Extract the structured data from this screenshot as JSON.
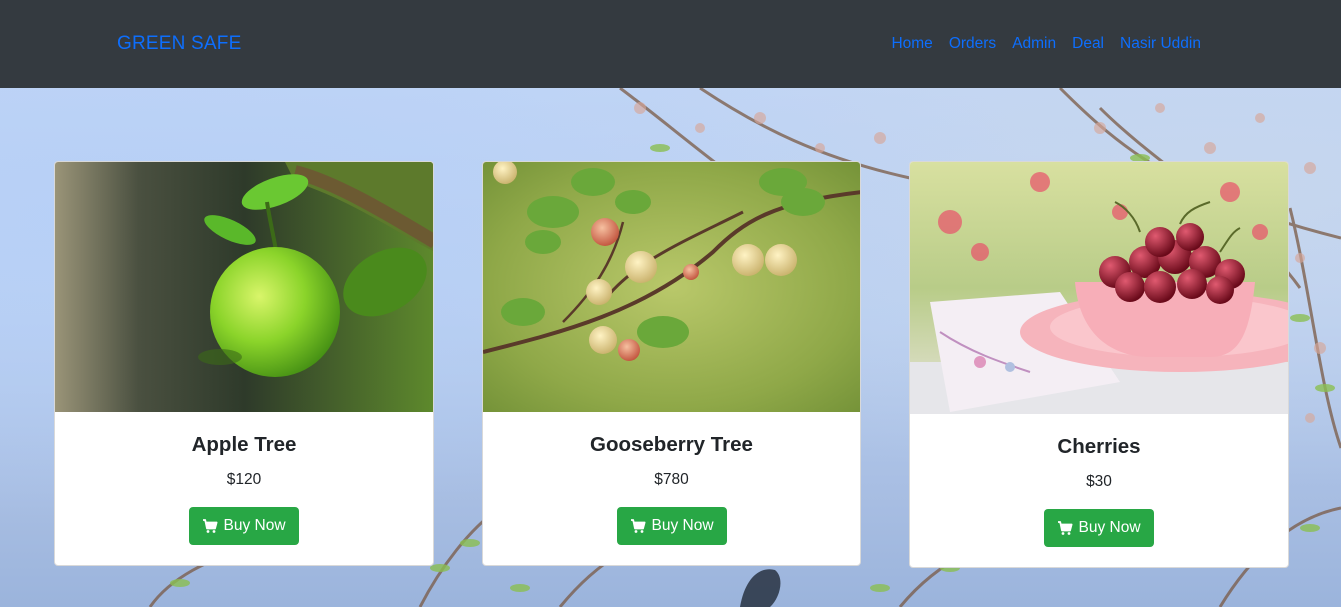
{
  "navbar": {
    "brand": "GREEN SAFE",
    "links": [
      "Home",
      "Orders",
      "Admin",
      "Deal",
      "Nasir Uddin"
    ]
  },
  "products": [
    {
      "title": "Apple Tree",
      "price": "$120",
      "button": "Buy Now",
      "image": "green-apple-photo"
    },
    {
      "title": "Gooseberry Tree",
      "price": "$780",
      "button": "Buy Now",
      "image": "gooseberry-branch-photo"
    },
    {
      "title": "Cherries",
      "price": "$30",
      "button": "Buy Now",
      "image": "cherries-bowl-photo"
    }
  ],
  "colors": {
    "navbar_bg": "#343a40",
    "link": "#0d6efd",
    "button": "#28a745"
  },
  "icons": {
    "buy_button": "shopping-cart-icon"
  }
}
